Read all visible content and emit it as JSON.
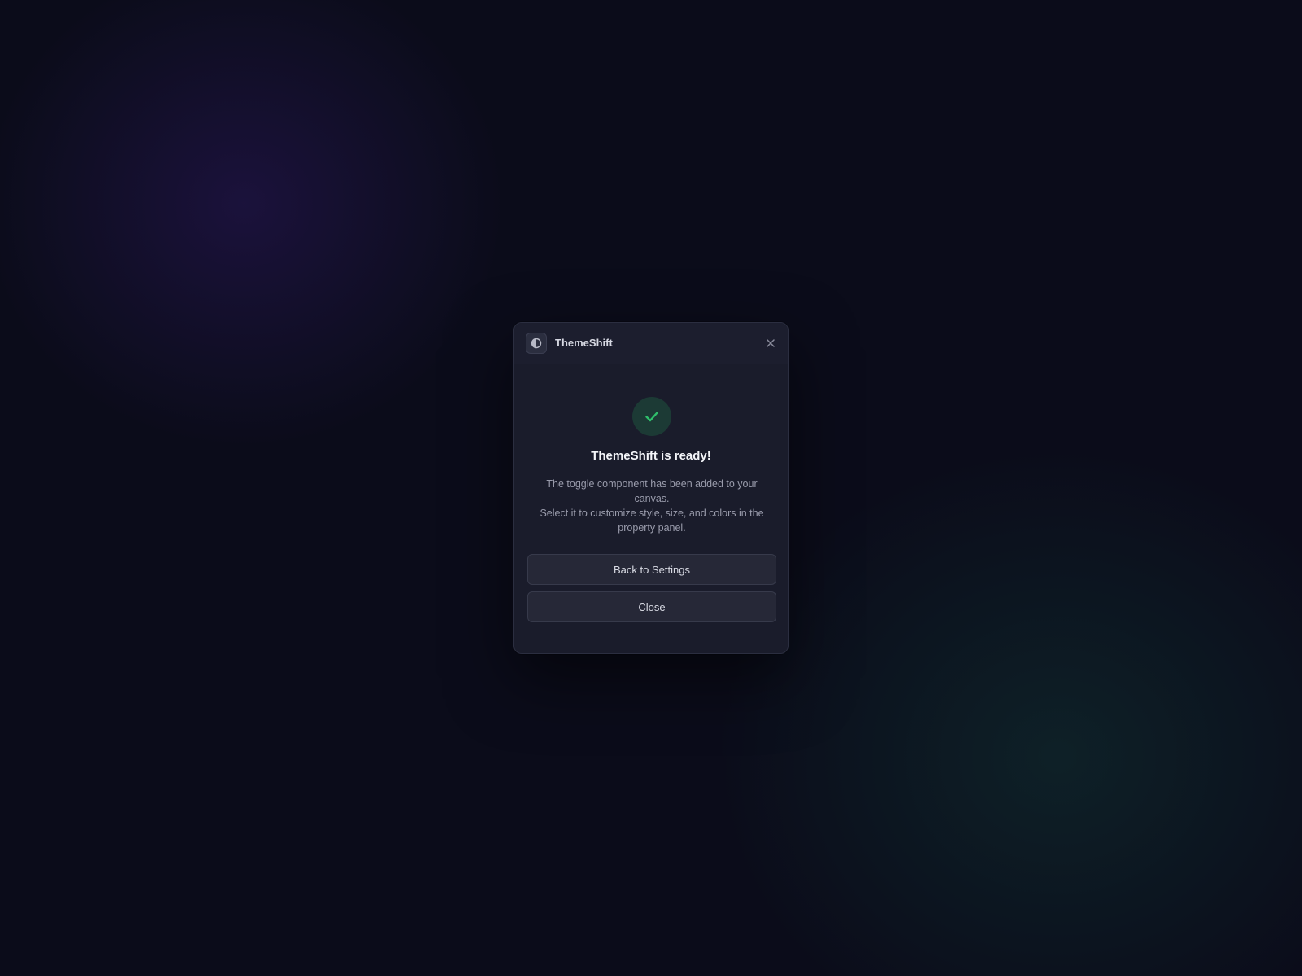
{
  "dialog": {
    "app_name": "ThemeShift",
    "app_icon": "half-circle-theme-icon",
    "close_icon": "close-icon",
    "success_icon": "checkmark-icon",
    "title": "ThemeShift is ready!",
    "description_line1": "The toggle component has been added to your canvas.",
    "description_line2": "Select it to customize style, size, and colors in the property panel.",
    "back_button_label": "Back to Settings",
    "close_button_label": "Close"
  },
  "colors": {
    "background": "#0b0c1a",
    "dialog_bg": "#1a1c2b",
    "success_green": "#2fbf6b",
    "success_circle_bg": "#1c3a35",
    "button_bg": "#262837"
  }
}
